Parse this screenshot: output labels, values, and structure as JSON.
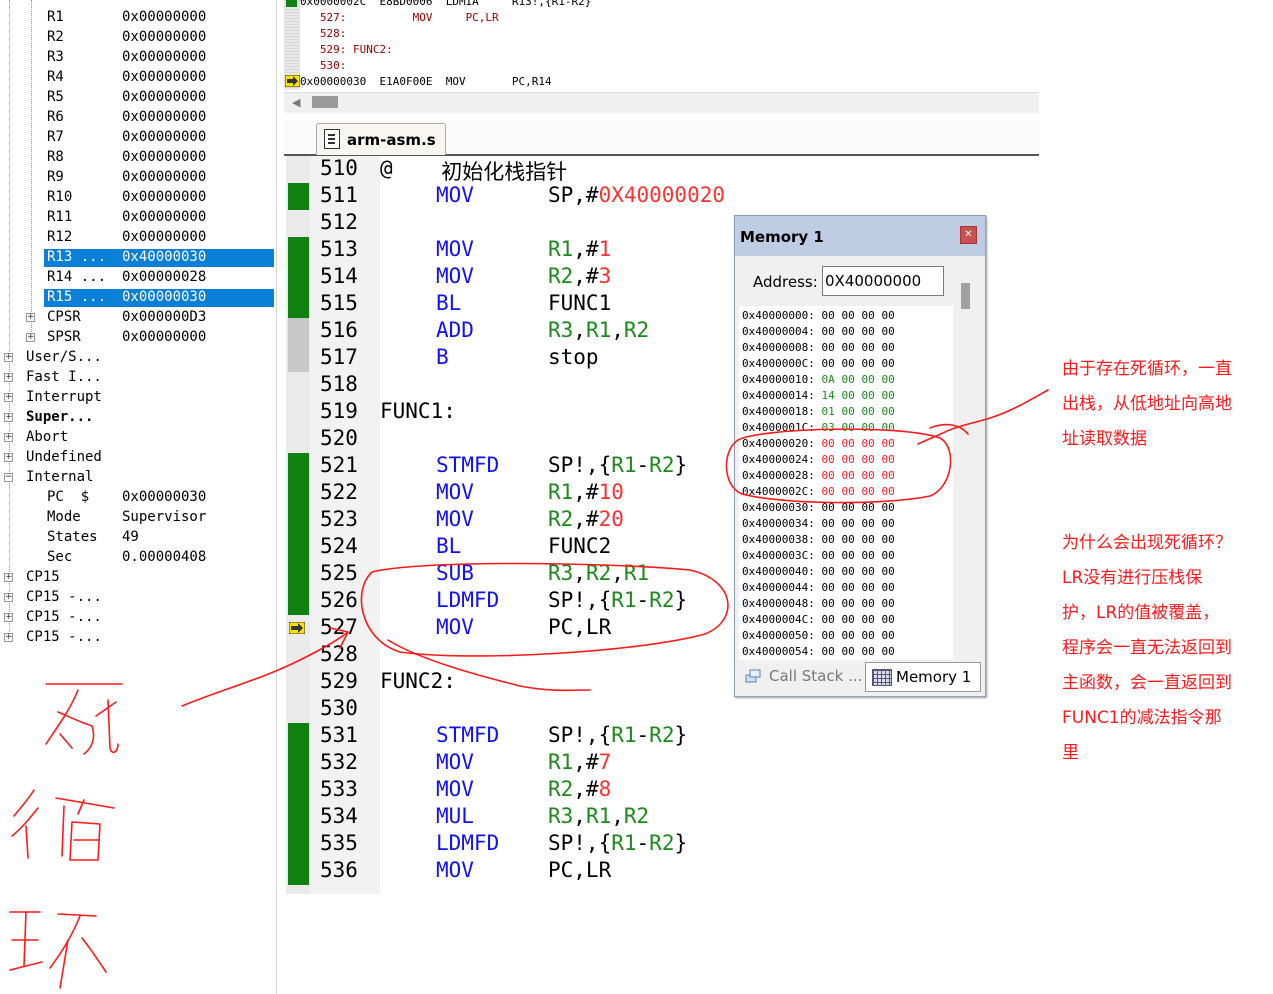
{
  "registers": {
    "rows": [
      {
        "name": "R1",
        "value": "0x00000000"
      },
      {
        "name": "R2",
        "value": "0x00000000"
      },
      {
        "name": "R3",
        "value": "0x00000000"
      },
      {
        "name": "R4",
        "value": "0x00000000"
      },
      {
        "name": "R5",
        "value": "0x00000000"
      },
      {
        "name": "R6",
        "value": "0x00000000"
      },
      {
        "name": "R7",
        "value": "0x00000000"
      },
      {
        "name": "R8",
        "value": "0x00000000"
      },
      {
        "name": "R9",
        "value": "0x00000000"
      },
      {
        "name": "R10",
        "value": "0x00000000"
      },
      {
        "name": "R11",
        "value": "0x00000000"
      },
      {
        "name": "R12",
        "value": "0x00000000"
      },
      {
        "name": "R13 ...",
        "value": "0x40000030",
        "selected": true
      },
      {
        "name": "R14 ...",
        "value": "0x00000028"
      },
      {
        "name": "R15 ...",
        "value": "0x00000030",
        "selected": true
      },
      {
        "name": "CPSR",
        "value": "0x000000D3",
        "expandable": true
      },
      {
        "name": "SPSR",
        "value": "0x00000000",
        "expandable": true
      }
    ],
    "modes": [
      "User/S...",
      "Fast I...",
      "Interrupt",
      "Super...",
      "Abort",
      "Undefined",
      "Internal"
    ],
    "internal": [
      {
        "name": "PC  $",
        "value": "0x00000030"
      },
      {
        "name": "Mode",
        "value": "Supervisor"
      },
      {
        "name": "States",
        "value": "49"
      },
      {
        "name": "Sec",
        "value": "0.00000408"
      }
    ],
    "cp15": [
      "CP15",
      "CP15 -...",
      "CP15 -...",
      "CP15 -..."
    ]
  },
  "disassembly": {
    "rows": [
      {
        "kind": "ins",
        "text": "0x0000002C  E8BD0006  LDMIA     R13!,{R1-R2}"
      },
      {
        "kind": "src",
        "text": "   527:          MOV     PC,LR"
      },
      {
        "kind": "src",
        "text": "   528:"
      },
      {
        "kind": "src",
        "text": "   529: FUNC2:"
      },
      {
        "kind": "src",
        "text": "   530:"
      },
      {
        "kind": "ins",
        "text": "0x00000030  E1A0F00E  MOV       PC,R14"
      }
    ]
  },
  "editor": {
    "tab_label": "arm-asm.s",
    "lines": [
      {
        "n": "510",
        "label": "@",
        "comment": "  初始化栈指针",
        "mark": ""
      },
      {
        "n": "511",
        "op": "MOV",
        "args": [
          [
            "SP,#",
            ""
          ],
          [
            "0X40000020",
            "cn"
          ]
        ],
        "mark": "g"
      },
      {
        "n": "512",
        "mark": ""
      },
      {
        "n": "513",
        "op": "MOV",
        "args": [
          [
            "R1",
            "rg"
          ],
          [
            ",#",
            ""
          ],
          [
            "1",
            "cn"
          ]
        ],
        "mark": "g"
      },
      {
        "n": "514",
        "op": "MOV",
        "args": [
          [
            "R2",
            "rg"
          ],
          [
            ",#",
            ""
          ],
          [
            "3",
            "cn"
          ]
        ],
        "mark": "g"
      },
      {
        "n": "515",
        "op": "BL",
        "args": [
          [
            "FUNC1",
            ""
          ]
        ],
        "mark": "g"
      },
      {
        "n": "516",
        "op": "ADD",
        "args": [
          [
            "R3",
            "rg"
          ],
          [
            ",",
            ""
          ],
          [
            "R1",
            "rg"
          ],
          [
            ",",
            ""
          ],
          [
            "R2",
            "rg"
          ]
        ],
        "mark": "gray"
      },
      {
        "n": "517",
        "op": "B",
        "args": [
          [
            "stop",
            ""
          ]
        ],
        "mark": "gray"
      },
      {
        "n": "518",
        "mark": ""
      },
      {
        "n": "519",
        "label": "FUNC1:",
        "mark": ""
      },
      {
        "n": "520",
        "mark": ""
      },
      {
        "n": "521",
        "op": "STMFD",
        "args": [
          [
            "SP!,{",
            ""
          ],
          [
            "R1",
            "rg"
          ],
          [
            "-",
            ""
          ],
          [
            "R2",
            "rg"
          ],
          [
            "}",
            ""
          ]
        ],
        "mark": "g"
      },
      {
        "n": "522",
        "op": "MOV",
        "args": [
          [
            "R1",
            "rg"
          ],
          [
            ",#",
            ""
          ],
          [
            "10",
            "cn"
          ]
        ],
        "mark": "g"
      },
      {
        "n": "523",
        "op": "MOV",
        "args": [
          [
            "R2",
            "rg"
          ],
          [
            ",#",
            ""
          ],
          [
            "20",
            "cn"
          ]
        ],
        "mark": "g"
      },
      {
        "n": "524",
        "op": "BL",
        "args": [
          [
            "FUNC2",
            ""
          ]
        ],
        "mark": "g"
      },
      {
        "n": "525",
        "op": "SUB",
        "args": [
          [
            "R3",
            "rg"
          ],
          [
            ",",
            ""
          ],
          [
            "R2",
            "rg"
          ],
          [
            ",",
            ""
          ],
          [
            "R1",
            "rg"
          ]
        ],
        "mark": "g"
      },
      {
        "n": "526",
        "op": "LDMFD",
        "args": [
          [
            "SP!,{",
            ""
          ],
          [
            "R1",
            "rg"
          ],
          [
            "-",
            ""
          ],
          [
            "R2",
            "rg"
          ],
          [
            "}",
            ""
          ]
        ],
        "mark": "g"
      },
      {
        "n": "527",
        "op": "MOV",
        "args": [
          [
            "PC,LR",
            ""
          ]
        ],
        "mark": "arrow"
      },
      {
        "n": "528",
        "mark": ""
      },
      {
        "n": "529",
        "label": "FUNC2:",
        "mark": ""
      },
      {
        "n": "530",
        "mark": ""
      },
      {
        "n": "531",
        "op": "STMFD",
        "args": [
          [
            "SP!,{",
            ""
          ],
          [
            "R1",
            "rg"
          ],
          [
            "-",
            ""
          ],
          [
            "R2",
            "rg"
          ],
          [
            "}",
            ""
          ]
        ],
        "mark": "g"
      },
      {
        "n": "532",
        "op": "MOV",
        "args": [
          [
            "R1",
            "rg"
          ],
          [
            ",#",
            ""
          ],
          [
            "7",
            "cn"
          ]
        ],
        "mark": "g"
      },
      {
        "n": "533",
        "op": "MOV",
        "args": [
          [
            "R2",
            "rg"
          ],
          [
            ",#",
            ""
          ],
          [
            "8",
            "cn"
          ]
        ],
        "mark": "g"
      },
      {
        "n": "534",
        "op": "MUL",
        "args": [
          [
            "R3",
            "rg"
          ],
          [
            ",",
            ""
          ],
          [
            "R1",
            "rg"
          ],
          [
            ",",
            ""
          ],
          [
            "R2",
            "rg"
          ]
        ],
        "mark": "g"
      },
      {
        "n": "535",
        "op": "LDMFD",
        "args": [
          [
            "SP!,{",
            ""
          ],
          [
            "R1",
            "rg"
          ],
          [
            "-",
            ""
          ],
          [
            "R2",
            "rg"
          ],
          [
            "}",
            ""
          ]
        ],
        "mark": "g"
      },
      {
        "n": "536",
        "op": "MOV",
        "args": [
          [
            "PC,LR",
            ""
          ]
        ],
        "mark": "g"
      }
    ]
  },
  "memory": {
    "title": "Memory 1",
    "close_icon": "close-icon",
    "address_label": "Address:",
    "address_value": "0X40000000",
    "rows": [
      {
        "addr": "0x40000000:",
        "bytes": [
          "00",
          "00",
          "00",
          "00"
        ],
        "color": "k"
      },
      {
        "addr": "0x40000004:",
        "bytes": [
          "00",
          "00",
          "00",
          "00"
        ],
        "color": "k"
      },
      {
        "addr": "0x40000008:",
        "bytes": [
          "00",
          "00",
          "00",
          "00"
        ],
        "color": "k"
      },
      {
        "addr": "0x4000000C:",
        "bytes": [
          "00",
          "00",
          "00",
          "00"
        ],
        "color": "k"
      },
      {
        "addr": "0x40000010:",
        "bytes": [
          "0A",
          "00",
          "00",
          "00"
        ],
        "color": "g"
      },
      {
        "addr": "0x40000014:",
        "bytes": [
          "14",
          "00",
          "00",
          "00"
        ],
        "color": "g"
      },
      {
        "addr": "0x40000018:",
        "bytes": [
          "01",
          "00",
          "00",
          "00"
        ],
        "color": "g"
      },
      {
        "addr": "0x4000001C:",
        "bytes": [
          "03",
          "00",
          "00",
          "00"
        ],
        "color": "g"
      },
      {
        "addr": "0x40000020:",
        "bytes": [
          "00",
          "00",
          "00",
          "00"
        ],
        "color": "r"
      },
      {
        "addr": "0x40000024:",
        "bytes": [
          "00",
          "00",
          "00",
          "00"
        ],
        "color": "r"
      },
      {
        "addr": "0x40000028:",
        "bytes": [
          "00",
          "00",
          "00",
          "00"
        ],
        "color": "r"
      },
      {
        "addr": "0x4000002C:",
        "bytes": [
          "00",
          "00",
          "00",
          "00"
        ],
        "color": "r"
      },
      {
        "addr": "0x40000030:",
        "bytes": [
          "00",
          "00",
          "00",
          "00"
        ],
        "color": "k"
      },
      {
        "addr": "0x40000034:",
        "bytes": [
          "00",
          "00",
          "00",
          "00"
        ],
        "color": "k"
      },
      {
        "addr": "0x40000038:",
        "bytes": [
          "00",
          "00",
          "00",
          "00"
        ],
        "color": "k"
      },
      {
        "addr": "0x4000003C:",
        "bytes": [
          "00",
          "00",
          "00",
          "00"
        ],
        "color": "k"
      },
      {
        "addr": "0x40000040:",
        "bytes": [
          "00",
          "00",
          "00",
          "00"
        ],
        "color": "k"
      },
      {
        "addr": "0x40000044:",
        "bytes": [
          "00",
          "00",
          "00",
          "00"
        ],
        "color": "k"
      },
      {
        "addr": "0x40000048:",
        "bytes": [
          "00",
          "00",
          "00",
          "00"
        ],
        "color": "k"
      },
      {
        "addr": "0x4000004C:",
        "bytes": [
          "00",
          "00",
          "00",
          "00"
        ],
        "color": "k"
      },
      {
        "addr": "0x40000050:",
        "bytes": [
          "00",
          "00",
          "00",
          "00"
        ],
        "color": "k"
      },
      {
        "addr": "0x40000054:",
        "bytes": [
          "00",
          "00",
          "00",
          "00"
        ],
        "color": "k"
      }
    ],
    "tabs": {
      "call_stack": "Call Stack ...",
      "memory1": "Memory 1"
    }
  },
  "annotations": {
    "note1_lines": [
      "由于存在死循环，一直",
      "出栈，从低地址向高地",
      "址读取数据"
    ],
    "note2_lines": [
      "为什么会出现死循环？",
      "LR没有进行压栈保",
      "护，LR的值被覆盖，",
      "程序会一直无法返回到",
      "主函数，会一直返回到",
      "FUNC1的减法指令那",
      "里"
    ],
    "handwritten": "死循环"
  },
  "colors": {
    "selection": "#0a7fd8",
    "breakpoint_green": "#108010",
    "keyword_blue": "#1010ff",
    "constant_red": "#ff3030",
    "register_green": "#1a8a1a",
    "annotation_red": "#ff1a1a"
  }
}
